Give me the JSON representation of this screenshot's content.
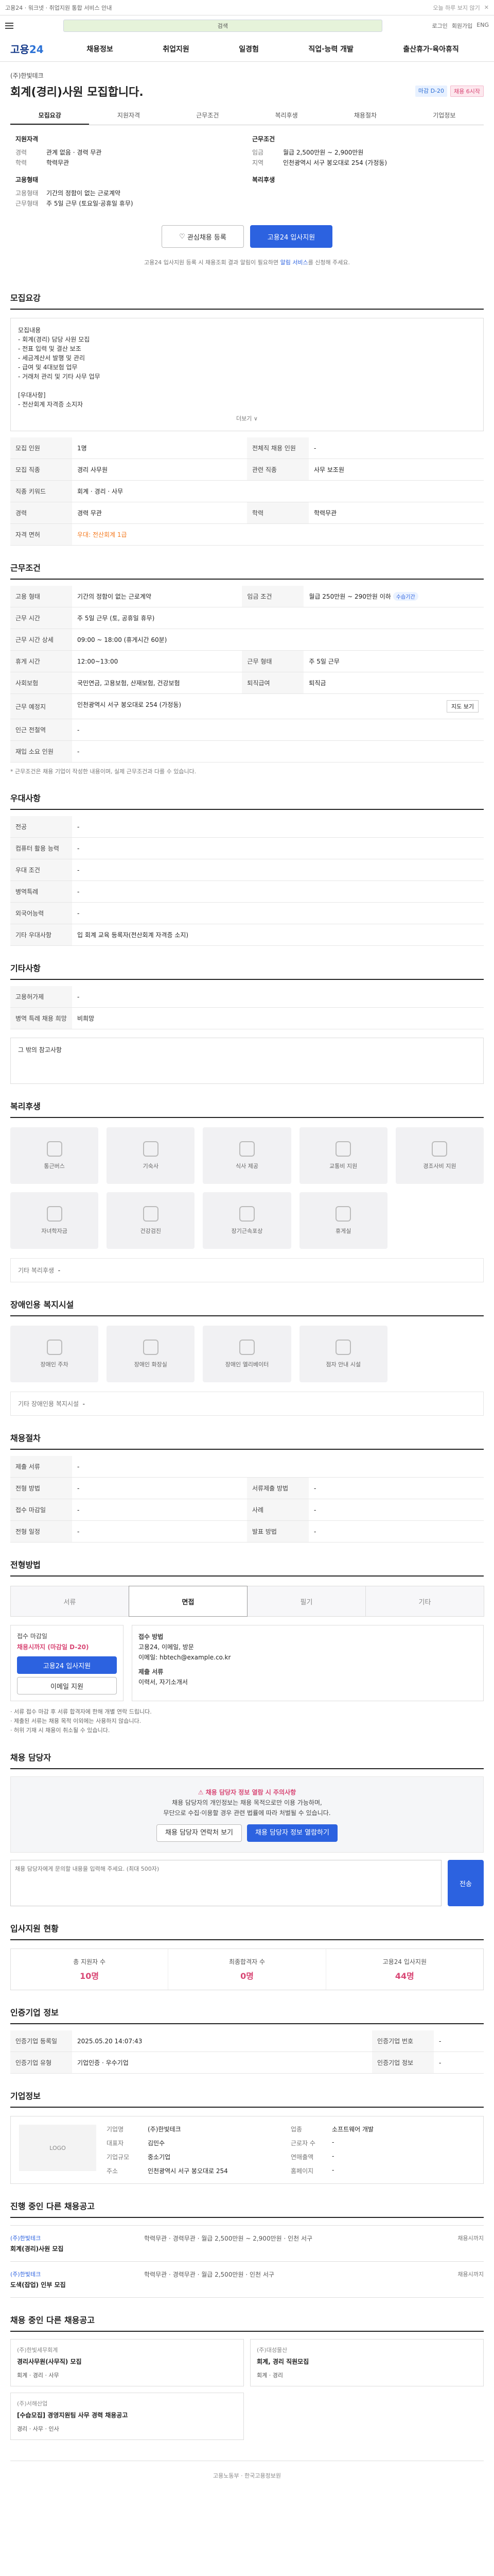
{
  "banner": {
    "text": "고용24 · 워크넷 · 취업지원 통합 서비스 안내",
    "close": "오늘 하루 보지 않기",
    "x": "✕"
  },
  "header": {
    "search_placeholder": "검색",
    "util": [
      "로그인",
      "회원가입",
      "ENG"
    ],
    "logo_main": "고용",
    "logo_num": "24",
    "menus": [
      "채용정보",
      "취업지원",
      "일경험",
      "직업·능력 개발",
      "출산휴가·육아휴직"
    ]
  },
  "job": {
    "company": "(주)한빛테크",
    "title": "회계(경리)사원 모집합니다.",
    "badges": [
      "마감 D-20",
      "채용 6시작"
    ],
    "tabs": [
      "모집요강",
      "지원자격",
      "근무조건",
      "복리후생",
      "채용절차",
      "기업정보"
    ],
    "summary_left_title": "지원자격",
    "summary_left": [
      {
        "k": "경력",
        "v": "관계 없음 · 경력 무관"
      },
      {
        "k": "학력",
        "v": "학력무관"
      }
    ],
    "summary_left_title2": "고용형태",
    "summary_left2": [
      {
        "k": "고용형태",
        "v": "기간의 정함이 없는 근로계약"
      },
      {
        "k": "근무형태",
        "v": "주 5일 근무 (토요일·공휴일 휴무)"
      }
    ],
    "summary_right_title": "근무조건",
    "summary_right": [
      {
        "k": "임금",
        "v": "월급 2,500만원 ~ 2,900만원"
      },
      {
        "k": "지역",
        "v": "인천광역시 서구 봉오대로 254 (가정동)"
      }
    ],
    "summary_right_title2": "복리후생",
    "btn_save": "관심채용 등록",
    "btn_apply": "고용24 입사지원",
    "note_pre": "고용24 입사지원 등록 시 채용조회 결과 알림이 필요하면 ",
    "note_hl": "알림 서비스",
    "note_post": "를 신청해 주세요."
  },
  "sections": {
    "recruit": "모집요강",
    "conditions": "근무조건",
    "qualify": "우대사항",
    "etc": "기타사항",
    "welfare": "복리후생",
    "disabled": "장애인용 복지시설",
    "process": "채용절차",
    "steps_title": "전형방법",
    "contact": "채용 담당자",
    "applicants": "입사지원 현황",
    "history": "인증기업 정보",
    "company": "기업정보",
    "other_jobs": "진행 중인 다른 채용공고",
    "more_jobs": "채용 중인 다른 채용공고"
  },
  "intro": {
    "lines": [
      "모집내용",
      "- 회계(경리) 담당 사원 모집",
      "- 전표 입력 및 결산 보조",
      "- 세금계산서 발행 및 관리",
      "- 급여 및 4대보험 업무",
      "- 거래처 관리 및 기타 사무 업무",
      "",
      "[우대사항]",
      "- 전산회계 자격증 소지자"
    ],
    "more": "더보기 ∨"
  },
  "recruit_table": [
    {
      "k": "모집 인원",
      "v": "1명",
      "k2": "전체직 채용 인원",
      "v2": "-"
    },
    {
      "k": "모집 직종",
      "v": "경리 사무원",
      "k2": "관련 직종",
      "v2": "사무 보조원"
    },
    {
      "k": "직종 키워드",
      "v": "회계 · 경리 · 사무",
      "k2": "",
      "v2": ""
    },
    {
      "k": "경력",
      "v": "경력 무관",
      "k2": "학력",
      "v2": "학력무관"
    },
    {
      "k": "자격 면허",
      "v": "우대: 전산회계 1급",
      "k2": "",
      "v2": ""
    }
  ],
  "cond_table": [
    {
      "k": "고용 형태",
      "v": "기간의 정함이 없는 근로계약",
      "k2": "임금 조건",
      "v2": "월급 250만원 ~ 290만원 이하"
    },
    {
      "k": "근무 시간",
      "v": "주 5일 근무 (토, 공휴일 휴무)",
      "k2": "",
      "v2": ""
    },
    {
      "k": "근무 시간 상세",
      "v": "09:00 ~ 18:00 (휴게시간 60분)",
      "k2": "",
      "v2": ""
    },
    {
      "k": "휴게 시간",
      "v": "12:00~13:00",
      "k2": "근무 형태",
      "v2": "주 5일 근무"
    },
    {
      "k": "사회보험",
      "v": "국민연금, 고용보험, 산재보험, 건강보험",
      "k2": "퇴직급여",
      "v2": "퇴직금"
    },
    {
      "k": "근무 예정지",
      "v": "인천광역시 서구 봉오대로 254 (가정동)",
      "k2": "",
      "v2": ""
    },
    {
      "k": "인근 전철역",
      "v": "-",
      "k2": "",
      "v2": ""
    },
    {
      "k": "재입 소요 인원",
      "v": "-",
      "k2": "",
      "v2": ""
    }
  ],
  "cond_pill": "수습기간",
  "cond_dropdown": "지도 보기",
  "cond_footnote": "* 근무조건은 채용 기업이 작성한 내용이며, 실제 근무조건과 다를 수 있습니다.",
  "qualify_table": [
    {
      "k": "전공",
      "v": "-"
    },
    {
      "k": "컴퓨터 활용 능력",
      "v": "-"
    },
    {
      "k": "우대 조건",
      "v": "-"
    },
    {
      "k": "병역특례",
      "v": "-"
    },
    {
      "k": "외국어능력",
      "v": "-"
    },
    {
      "k": "기타 우대사항",
      "v": "입 회계 교육 등록자(전산회계 자격증 소지)"
    }
  ],
  "etc_table": [
    {
      "k": "고용허가제",
      "v": "-"
    },
    {
      "k": "병역 특례 채용 희망",
      "v": "비희망"
    }
  ],
  "etc_box": "그 밖의 참고사항",
  "welfare_tiles": [
    "통근버스",
    "기숙사",
    "식사 제공",
    "교통비 지원",
    "경조사비 지원",
    "자녀학자금",
    "건강검진",
    "장기근속포상",
    "휴게실",
    "기타"
  ],
  "welfare_other_k": "기타 복리후생",
  "welfare_other_v": "-",
  "disabled_tiles": [
    "장애인 주차",
    "장애인 화장실",
    "장애인 엘리베이터",
    "점자 안내 시설"
  ],
  "disabled_other_k": "기타 장애인용 복지시설",
  "disabled_other_v": "-",
  "process_table": [
    {
      "k": "제출 서류",
      "v": "-",
      "k2": "",
      "v2": ""
    },
    {
      "k": "전형 방법",
      "v": "-",
      "k2": "서류제출 방법",
      "v2": "-"
    },
    {
      "k": "접수 마감일",
      "v": "-",
      "k2": "사례",
      "v2": "-"
    },
    {
      "k": "전형 일정",
      "v": "-",
      "k2": "발표 방법",
      "v2": "-"
    }
  ],
  "steps": [
    "서류",
    "면접",
    "필기",
    "기타"
  ],
  "apply": {
    "left_title": "접수 마감일",
    "left_date": "채용시까지 (마감일 D-20)",
    "btn_apply": "고용24 입사지원",
    "btn_email": "이메일 지원",
    "right_h1": "접수 방법",
    "right_v1": "고용24, 이메일, 방문",
    "right_v2": "이메일: hbtech@example.co.kr",
    "right_h2": "제출 서류",
    "right_v3": "이력서, 자기소개서"
  },
  "bullets": [
    "· 서류 접수 마감 후 서류 합격자에 한해 개별 연락 드립니다.",
    "· 제출된 서류는 채용 목적 이외에는 사용하지 않습니다.",
    "· 허위 기재 시 채용이 취소될 수 있습니다."
  ],
  "contact": {
    "warn": "채용 담당자 정보 열람 시 주의사항",
    "line1": "채용 담당자의 개인정보는 채용 목적으로만 이용 가능하며,",
    "line2": "무단으로 수집·이용할 경우 관련 법률에 따라 처벌될 수 있습니다.",
    "btn1": "채용 담당자 연락처 보기",
    "btn2": "채용 담당자 정보 열람하기"
  },
  "inquiry": {
    "placeholder": "채용 담당자에게 문의할 내용을 입력해 주세요. (최대 500자)",
    "btn": "전송"
  },
  "counts": [
    {
      "label": "총 지원자 수",
      "n": "10명"
    },
    {
      "label": "최종합격자 수",
      "n": "0명"
    },
    {
      "label": "고용24 입사지원",
      "n": "44명"
    }
  ],
  "history_table": [
    {
      "k": "인증기업 등록일",
      "v": "2025.05.20 14:07:43",
      "k2": "인증기업 번호",
      "v2": "-"
    },
    {
      "k": "인증기업 유형",
      "v": "기업인증 · 우수기업",
      "k2": "인증기업 정보",
      "v2": "-"
    }
  ],
  "company": {
    "logo": "LOGO",
    "rows": [
      {
        "k": "기업명",
        "v": "(주)한빛테크",
        "k2": "업종",
        "v2": "소프트웨어 개발"
      },
      {
        "k": "대표자",
        "v": "김민수",
        "k2": "근로자 수",
        "v2": "-"
      },
      {
        "k": "기업규모",
        "v": "중소기업",
        "k2": "연매출액",
        "v2": "-"
      },
      {
        "k": "주소",
        "v": "인천광역시 서구 봉오대로 254",
        "k2": "홈페이지",
        "v2": "-"
      }
    ]
  },
  "other_jobs": [
    {
      "co": "(주)한빛테크",
      "tt": "회계(경리)사원 모집",
      "mid": "학력무관 · 경력무관 · 월급 2,500만원 ~ 2,900만원 · 인천 서구",
      "right": "채용시까지"
    },
    {
      "co": "(주)한빛테크",
      "tt": "도색(잡업) 인부 모집",
      "mid": "학력무관 · 경력무관 · 월급 2,500만원 · 인천 서구",
      "right": "채용시까지"
    }
  ],
  "more_cards": [
    {
      "co": "(주)한빛세무회계",
      "tt": "경리사무원(사무직) 모집",
      "tags": "회계 · 경리 · 사무"
    },
    {
      "co": "(주)대성물산",
      "tt": "회계, 경리 직원모집",
      "tags": "회계 · 경리"
    },
    {
      "co": "(주)서해산업",
      "tt": "[수습모집] 경영지원팀 사무 경력 채용공고",
      "tags": "경리 · 사무 · 인사"
    },
    {
      "co": "",
      "tt": "",
      "tags": ""
    }
  ],
  "footer": "고용노동부 · 한국고용정보원"
}
